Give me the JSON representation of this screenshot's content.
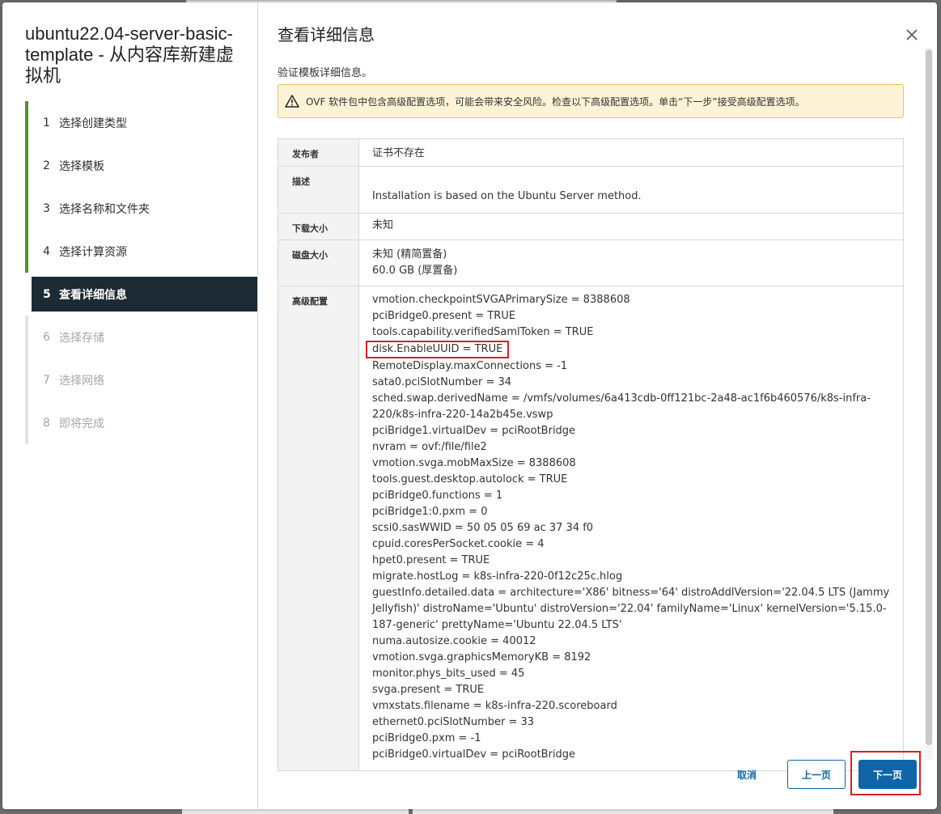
{
  "wizard": {
    "title": "ubuntu22.04-server-basic-template - 从内容库新建虚拟机",
    "steps": [
      {
        "num": "1",
        "label": "选择创建类型",
        "state": "done"
      },
      {
        "num": "2",
        "label": "选择模板",
        "state": "done"
      },
      {
        "num": "3",
        "label": "选择名称和文件夹",
        "state": "done"
      },
      {
        "num": "4",
        "label": "选择计算资源",
        "state": "done"
      },
      {
        "num": "5",
        "label": "查看详细信息",
        "state": "active"
      },
      {
        "num": "6",
        "label": "选择存储",
        "state": "disabled"
      },
      {
        "num": "7",
        "label": "选择网络",
        "state": "disabled"
      },
      {
        "num": "8",
        "label": "即将完成",
        "state": "disabled"
      }
    ]
  },
  "main": {
    "title": "查看详细信息",
    "subtitle": "验证模板详细信息。",
    "alert": "OVF 软件包中包含高级配置选项，可能会带来安全风险。检查以下高级配置选项。单击“下一步”接受高级配置选项。",
    "details": {
      "publisher_label": "发布者",
      "publisher_value": "证书不存在",
      "description_label": "描述",
      "description_value": "Installation is based on the Ubuntu Server method.",
      "download_size_label": "下载大小",
      "download_size_value": "未知",
      "disk_size_label": "磁盘大小",
      "disk_size_line1": "未知 (精简置备)",
      "disk_size_line2": "60.0 GB (厚置备)",
      "advanced_label": "高级配置",
      "advanced": [
        "vmotion.checkpointSVGAPrimarySize = 8388608",
        "pciBridge0.present = TRUE",
        "tools.capability.verifiedSamlToken = TRUE",
        "disk.EnableUUID = TRUE",
        "RemoteDisplay.maxConnections = -1",
        "sata0.pciSlotNumber = 34",
        "sched.swap.derivedName = /vmfs/volumes/6a413cdb-0ff121bc-2a48-ac1f6b460576/k8s-infra-220/k8s-infra-220-14a2b45e.vswp",
        "pciBridge1.virtualDev = pciRootBridge",
        "nvram = ovf:/file/file2",
        "vmotion.svga.mobMaxSize = 8388608",
        "tools.guest.desktop.autolock = TRUE",
        "pciBridge0.functions = 1",
        "pciBridge1:0.pxm = 0",
        "scsi0.sasWWID = 50 05 05 69 ac 37 34 f0",
        "cpuid.coresPerSocket.cookie = 4",
        "hpet0.present = TRUE",
        "migrate.hostLog = k8s-infra-220-0f12c25c.hlog",
        "guestInfo.detailed.data = architecture='X86' bitness='64' distroAddlVersion='22.04.5 LTS (Jammy Jellyfish)' distroName='Ubuntu' distroVersion='22.04' familyName='Linux' kernelVersion='5.15.0-187-generic' prettyName='Ubuntu 22.04.5 LTS'",
        "numa.autosize.cookie = 40012",
        "vmotion.svga.graphicsMemoryKB = 8192",
        "monitor.phys_bits_used = 45",
        "svga.present = TRUE",
        "vmxstats.filename = k8s-infra-220.scoreboard",
        "ethernet0.pciSlotNumber = 33",
        "pciBridge0.pxm = -1",
        "pciBridge0.virtualDev = pciRootBridge"
      ]
    }
  },
  "footer": {
    "cancel": "取消",
    "back": "上一页",
    "next": "下一页"
  },
  "icons": [
    "close-icon",
    "warning-icon"
  ],
  "colors": {
    "accent": "#0f65a8",
    "active_step_bg": "#1c2a33",
    "done_bar": "#5a8f2c",
    "highlight": "#d82020",
    "alert_bg": "#fef3d6"
  }
}
